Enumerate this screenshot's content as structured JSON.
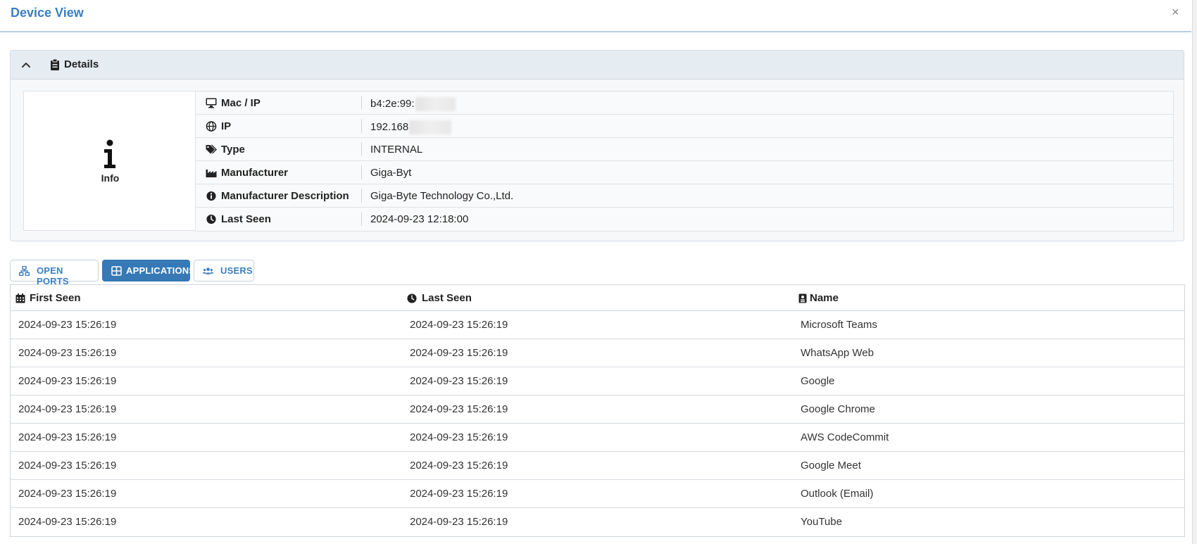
{
  "modal": {
    "title": "Device View",
    "close_glyph": "×"
  },
  "details": {
    "header_label": "Details",
    "info_label": "Info",
    "rows": [
      {
        "icon": "monitor-icon",
        "key": "Mac / IP",
        "value": "b4:2e:99:"
      },
      {
        "icon": "globe-icon",
        "key": "IP",
        "value": "192.168"
      },
      {
        "icon": "tags-icon",
        "key": "Type",
        "value": "INTERNAL"
      },
      {
        "icon": "industry-icon",
        "key": "Manufacturer",
        "value": "Giga-Byt"
      },
      {
        "icon": "info-circle-icon",
        "key": "Manufacturer Description",
        "value": "Giga-Byte Technology Co.,Ltd."
      },
      {
        "icon": "clock-icon",
        "key": "Last Seen",
        "value": "2024-09-23 12:18:00"
      }
    ]
  },
  "tabs": [
    {
      "label": "OPEN PORTS",
      "icon": "sitemap-icon",
      "active": false
    },
    {
      "label": "APPLICATIONS",
      "icon": "grid-icon",
      "active": true
    },
    {
      "label": "USERS",
      "icon": "users-icon",
      "active": false
    }
  ],
  "table": {
    "columns": [
      {
        "label": "First Seen",
        "icon": "calendar-icon"
      },
      {
        "label": "Last Seen",
        "icon": "clock-icon"
      },
      {
        "label": "Name",
        "icon": "id-badge-icon"
      }
    ],
    "rows": [
      {
        "first_seen": "2024-09-23 15:26:19",
        "last_seen": "2024-09-23 15:26:19",
        "name": "Microsoft Teams"
      },
      {
        "first_seen": "2024-09-23 15:26:19",
        "last_seen": "2024-09-23 15:26:19",
        "name": "WhatsApp Web"
      },
      {
        "first_seen": "2024-09-23 15:26:19",
        "last_seen": "2024-09-23 15:26:19",
        "name": "Google"
      },
      {
        "first_seen": "2024-09-23 15:26:19",
        "last_seen": "2024-09-23 15:26:19",
        "name": "Google Chrome"
      },
      {
        "first_seen": "2024-09-23 15:26:19",
        "last_seen": "2024-09-23 15:26:19",
        "name": "AWS CodeCommit"
      },
      {
        "first_seen": "2024-09-23 15:26:19",
        "last_seen": "2024-09-23 15:26:19",
        "name": "Google Meet"
      },
      {
        "first_seen": "2024-09-23 15:26:19",
        "last_seen": "2024-09-23 15:26:19",
        "name": "Outlook (Email)"
      },
      {
        "first_seen": "2024-09-23 15:26:19",
        "last_seen": "2024-09-23 15:26:19",
        "name": "YouTube"
      }
    ]
  },
  "colors": {
    "accent": "#3a7fc0",
    "active_tab": "#3679b5",
    "panel_head": "#e5ecf2"
  }
}
